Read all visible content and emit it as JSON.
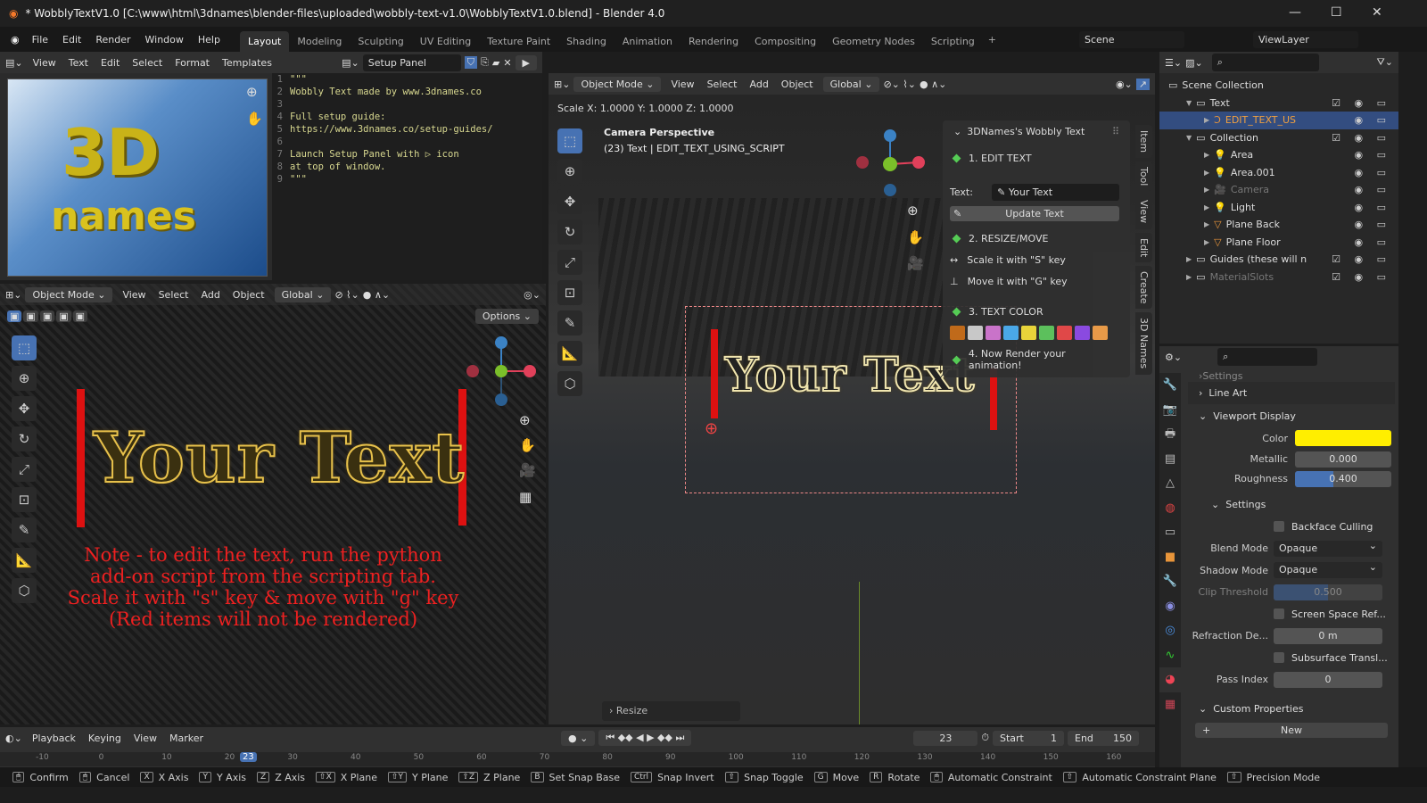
{
  "window": {
    "title": "* WobblyTextV1.0 [C:\\www\\html\\3dnames\\blender-files\\uploaded\\wobbly-text-v1.0\\WobblyTextV1.0.blend] - Blender 4.0"
  },
  "menu": [
    "File",
    "Edit",
    "Render",
    "Window",
    "Help"
  ],
  "workspaces": [
    "Layout",
    "Modeling",
    "Sculpting",
    "UV Editing",
    "Texture Paint",
    "Shading",
    "Animation",
    "Rendering",
    "Compositing",
    "Geometry Nodes",
    "Scripting"
  ],
  "scene": "Scene",
  "view_layer": "ViewLayer",
  "text_editor": {
    "menus": [
      "View",
      "Text",
      "Edit",
      "Select",
      "Format",
      "Templates"
    ],
    "file": "Setup Panel",
    "lines": [
      "\"\"\"",
      "Wobbly Text made by www.3dnames.co",
      "",
      "Full setup guide:",
      "https://www.3dnames.co/setup-guides/",
      "",
      "Launch Setup Panel with ▷ icon",
      "at top of window.",
      "\"\"\""
    ]
  },
  "logo_text": "3D names",
  "left_view": {
    "mode": "Object Mode",
    "menus": [
      "View",
      "Select",
      "Add",
      "Object"
    ],
    "orientation": "Global",
    "options": "Options",
    "text3d": "Your Text",
    "note": [
      "Note - to edit the text, run the python",
      "add-on script from the scripting tab.",
      "Scale it with \"s\" key & move with \"g\" key",
      "(Red items will not be rendered)"
    ]
  },
  "main_view": {
    "mode": "Object Mode",
    "menus": [
      "View",
      "Select",
      "Add",
      "Object"
    ],
    "orientation": "Global",
    "scale_readout": "Scale X: 1.0000   Y: 1.0000  Z: 1.0000",
    "camera": "Camera Perspective",
    "object": "(23) Text | EDIT_TEXT_USING_SCRIPT",
    "text3d": "Your Text",
    "operator": "Resize",
    "side_tabs": [
      "Item",
      "Tool",
      "View",
      "Edit",
      "Create",
      "3D Names"
    ]
  },
  "wobbly_panel": {
    "title": "3DNames's Wobbly Text",
    "step1": "1. EDIT TEXT",
    "text_label": "Text:",
    "text_value": "Your Text",
    "update": "Update Text",
    "step2": "2. RESIZE/MOVE",
    "scale": "Scale it with \"S\" key",
    "move": "Move it with \"G\" key",
    "step3": "3. TEXT COLOR",
    "colors": [
      "#c06a1a",
      "#c8c8c8",
      "#c973c9",
      "#4aa8e8",
      "#e8d43a",
      "#5cc05c",
      "#e04848",
      "#8a4ae0",
      "#e89a48"
    ],
    "step4": "4. Now Render your animation!"
  },
  "outliner": {
    "items": [
      {
        "name": "Scene Collection",
        "depth": 0,
        "type": "collection"
      },
      {
        "name": "Text",
        "depth": 1,
        "type": "collection"
      },
      {
        "name": "EDIT_TEXT_US",
        "depth": 2,
        "type": "text",
        "selected": true
      },
      {
        "name": "Collection",
        "depth": 1,
        "type": "collection"
      },
      {
        "name": "Area",
        "depth": 2,
        "type": "light"
      },
      {
        "name": "Area.001",
        "depth": 2,
        "type": "light"
      },
      {
        "name": "Camera",
        "depth": 2,
        "type": "camera",
        "dim": true
      },
      {
        "name": "Light",
        "depth": 2,
        "type": "light"
      },
      {
        "name": "Plane Back",
        "depth": 2,
        "type": "mesh"
      },
      {
        "name": "Plane Floor",
        "depth": 2,
        "type": "mesh"
      },
      {
        "name": "Guides (these will n",
        "depth": 1,
        "type": "collection"
      },
      {
        "name": "MaterialSlots",
        "depth": 1,
        "type": "collection",
        "dim": true
      }
    ]
  },
  "properties": {
    "settings_top": "Settings",
    "line_art": "Line Art",
    "viewport_display": "Viewport Display",
    "color_label": "Color",
    "color": "#ffee00",
    "metallic_label": "Metallic",
    "metallic": "0.000",
    "roughness_label": "Roughness",
    "roughness": "0.400",
    "roughness_value": 0.4,
    "settings": "Settings",
    "backface": "Backface Culling",
    "blend_label": "Blend Mode",
    "blend": "Opaque",
    "shadow_label": "Shadow Mode",
    "shadow": "Opaque",
    "clip_label": "Clip Threshold",
    "clip": "0.500",
    "clip_value": 0.5,
    "ssr": "Screen Space Ref...",
    "refr_label": "Refraction De...",
    "refr": "0 m",
    "sss": "Subsurface Transl...",
    "pass_label": "Pass Index",
    "pass": "0",
    "custom": "Custom Properties",
    "new": "New"
  },
  "timeline": {
    "menus": [
      "Playback",
      "Keying",
      "View",
      "Marker"
    ],
    "current": "23",
    "start_label": "Start",
    "start": "1",
    "end_label": "End",
    "end": "150",
    "ticks": [
      "-10",
      "0",
      "10",
      "20",
      "30",
      "40",
      "50",
      "60",
      "70",
      "80",
      "90",
      "100",
      "110",
      "120",
      "130",
      "140",
      "150",
      "160"
    ]
  },
  "status": [
    {
      "k": "",
      "t": "Confirm"
    },
    {
      "k": "",
      "t": "Cancel"
    },
    {
      "k": "X",
      "t": "X Axis"
    },
    {
      "k": "Y",
      "t": "Y Axis"
    },
    {
      "k": "Z",
      "t": "Z Axis"
    },
    {
      "k": "⇧X",
      "t": "X Plane"
    },
    {
      "k": "⇧Y",
      "t": "Y Plane"
    },
    {
      "k": "⇧Z",
      "t": "Z Plane"
    },
    {
      "k": "B",
      "t": "Set Snap Base"
    },
    {
      "k": "Ctrl",
      "t": "Snap Invert"
    },
    {
      "k": "⇧",
      "t": "Snap Toggle"
    },
    {
      "k": "G",
      "t": "Move"
    },
    {
      "k": "R",
      "t": "Rotate"
    },
    {
      "k": "",
      "t": "Automatic Constraint"
    },
    {
      "k": "⇧",
      "t": "Automatic Constraint Plane"
    },
    {
      "k": "⇧",
      "t": "Precision Mode"
    }
  ]
}
